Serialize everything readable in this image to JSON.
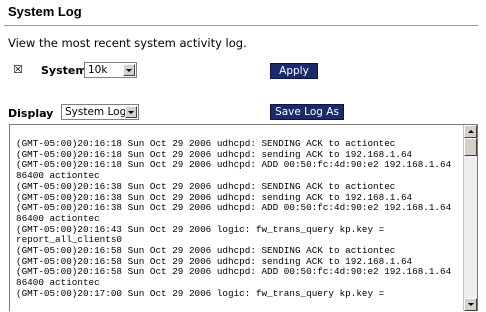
{
  "page": {
    "title": "System Log",
    "description": "View the most recent system activity log."
  },
  "system_log": {
    "checkbox_checked": true,
    "checkbox_glyph": "☒",
    "label": "System Log",
    "size_value": "10k",
    "apply_label": "Apply"
  },
  "display": {
    "label": "Display",
    "select_value": "System Log",
    "save_label": "Save Log As"
  },
  "log": {
    "lines": [
      "(GMT-05:00)20:16:18 Sun Oct 29 2006 udhcpd: SENDING ACK to actiontec",
      "(GMT-05:00)20:16:18 Sun Oct 29 2006 udhcpd: sending ACK to 192.168.1.64",
      "(GMT-05:00)20:16:18 Sun Oct 29 2006 udhcpd: ADD 00:50:fc:4d:90:e2 192.168.1.64",
      "86400 actiontec",
      "(GMT-05:00)20:16:38 Sun Oct 29 2006 udhcpd: SENDING ACK to actiontec",
      "(GMT-05:00)20:16:38 Sun Oct 29 2006 udhcpd: sending ACK to 192.168.1.64",
      "(GMT-05:00)20:16:38 Sun Oct 29 2006 udhcpd: ADD 00:50:fc:4d:90:e2 192.168.1.64",
      "86400 actiontec",
      "(GMT-05:00)20:16:43 Sun Oct 29 2006 logic: fw_trans_query kp.key =",
      "report_all_clients0",
      "(GMT-05:00)20:16:58 Sun Oct 29 2006 udhcpd: SENDING ACK to actiontec",
      "(GMT-05:00)20:16:58 Sun Oct 29 2006 udhcpd: sending ACK to 192.168.1.64",
      "(GMT-05:00)20:16:58 Sun Oct 29 2006 udhcpd: ADD 00:50:fc:4d:90:e2 192.168.1.64",
      "86400 actiontec",
      "(GMT-05:00)20:17:00 Sun Oct 29 2006 logic: fw_trans_query kp.key ="
    ]
  },
  "colors": {
    "button_bg": "#1b2a6b",
    "button_text": "#ffffff",
    "rule": "#9a9a9a"
  }
}
